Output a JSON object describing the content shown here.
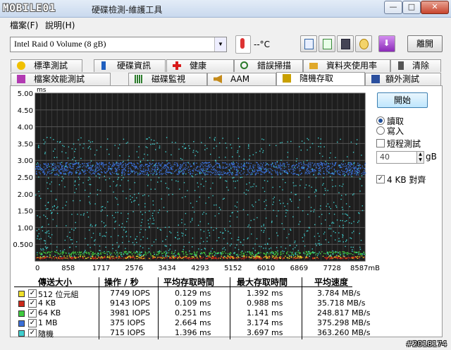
{
  "window": {
    "logo": "MOBILE01",
    "title": "硬碟檢測-維護工具",
    "buttons": {
      "minimize": "—",
      "maximize": "□",
      "close": "✕"
    }
  },
  "menu": [
    "檔案(F)",
    "說明(H)"
  ],
  "toolbar": {
    "drive": "Intel  Raid 0 Volume (8 gB)",
    "temperature": "--°C",
    "exit_label": "離開",
    "icons": [
      "copy-icon",
      "copy-screen-icon",
      "save-icon",
      "options-icon",
      "download-icon"
    ]
  },
  "tabs_row1": [
    {
      "label": "標準測試",
      "icon": "lightbulb-icon",
      "color": "#f0c000"
    },
    {
      "label": "硬碟資訊",
      "icon": "info-icon",
      "color": "#1f5fbf"
    },
    {
      "label": "健康",
      "icon": "health-cross-icon",
      "color": "#d81b1b"
    },
    {
      "label": "錯誤掃描",
      "icon": "magnifier-icon",
      "color": "#2b7a2b"
    },
    {
      "label": "資料夾使用率",
      "icon": "folder-icon",
      "color": "#e0a92a"
    },
    {
      "label": "清除",
      "icon": "trash-icon",
      "color": "#555555"
    }
  ],
  "tabs_row2": [
    {
      "label": "檔案效能測試",
      "icon": "file-benchmark-icon",
      "color": "#b23ab2"
    },
    {
      "label": "磁碟監視",
      "icon": "monitor-bars-icon",
      "color": "#2b7a2b"
    },
    {
      "label": "AAM",
      "icon": "speaker-icon",
      "color": "#c48a1a"
    },
    {
      "label": "隨機存取",
      "icon": "random-access-icon",
      "color": "#c9a000",
      "active": true
    },
    {
      "label": "額外測試",
      "icon": "extra-tests-icon",
      "color": "#2b4f9e"
    }
  ],
  "controls": {
    "start_label": "開始",
    "read_label": "讀取",
    "write_label": "寫入",
    "read_selected": true,
    "short_test_label": "短程測試",
    "short_test_checked": false,
    "short_test_value": "40",
    "short_test_unit": "gB",
    "align_label": "4 KB 對齊",
    "align_checked": true
  },
  "chart_data": {
    "type": "scatter",
    "ylabel": "ms",
    "xlabel": "mB",
    "y_ticks": [
      "5.00",
      "4.50",
      "4.00",
      "3.50",
      "3.00",
      "2.50",
      "2.00",
      "1.50",
      "1.00",
      "0.500"
    ],
    "y_tick_values": [
      5.0,
      4.5,
      4.0,
      3.5,
      3.0,
      2.5,
      2.0,
      1.5,
      1.0,
      0.5
    ],
    "x_ticks": [
      "0",
      "858",
      "1717",
      "2576",
      "3434",
      "4293",
      "5152",
      "6010",
      "6869",
      "7728",
      "8587mB"
    ],
    "x_tick_values": [
      0,
      858,
      1717,
      2576,
      3434,
      4293,
      5152,
      6010,
      6869,
      7728,
      8587
    ],
    "xlim": [
      0,
      8587
    ],
    "ylim": [
      0,
      5.0
    ],
    "grid": true,
    "series": [
      {
        "name": "512 位元組",
        "color": "#f0e02a",
        "band": [
          0.09,
          0.17
        ],
        "count": 300
      },
      {
        "name": "4 KB",
        "color": "#cc2a1a",
        "band": [
          0.08,
          0.14
        ],
        "count": 300
      },
      {
        "name": "64 KB",
        "color": "#3fcc3f",
        "band": [
          0.2,
          0.3
        ],
        "count": 380
      },
      {
        "name": "1 MB",
        "color": "#3a6fd8",
        "band": [
          2.58,
          2.95
        ],
        "count": 1300
      },
      {
        "name": "隨機",
        "color": "#3fcfcf",
        "band": [
          0.15,
          3.7
        ],
        "count": 1100
      }
    ]
  },
  "table": {
    "headers": [
      "傳送大小",
      "操作 / 秒",
      "平均存取時間",
      "最大存取時間",
      "平均速度"
    ],
    "rows": [
      {
        "color": "#f0e02a",
        "checked": true,
        "size": "512 位元組",
        "ops": "7749 IOPS",
        "avg": "0.129 ms",
        "max": "1.392 ms",
        "speed": "3.784 MB/s"
      },
      {
        "color": "#cc2a1a",
        "checked": true,
        "size": "4 KB",
        "ops": "9143 IOPS",
        "avg": "0.109 ms",
        "max": "0.988 ms",
        "speed": "35.718 MB/s"
      },
      {
        "color": "#3fcc3f",
        "checked": true,
        "size": "64 KB",
        "ops": "3981 IOPS",
        "avg": "0.251 ms",
        "max": "1.141 ms",
        "speed": "248.817 MB/s"
      },
      {
        "color": "#3a6fd8",
        "checked": true,
        "size": "1 MB",
        "ops": "375 IOPS",
        "avg": "2.664 ms",
        "max": "3.174 ms",
        "speed": "375.298 MB/s"
      },
      {
        "color": "#3fcfcf",
        "checked": true,
        "size": "隨機",
        "ops": "715 IOPS",
        "avg": "1.396 ms",
        "max": "3.697 ms",
        "speed": "363.260 MB/s"
      }
    ]
  },
  "watermark": "#2018174"
}
